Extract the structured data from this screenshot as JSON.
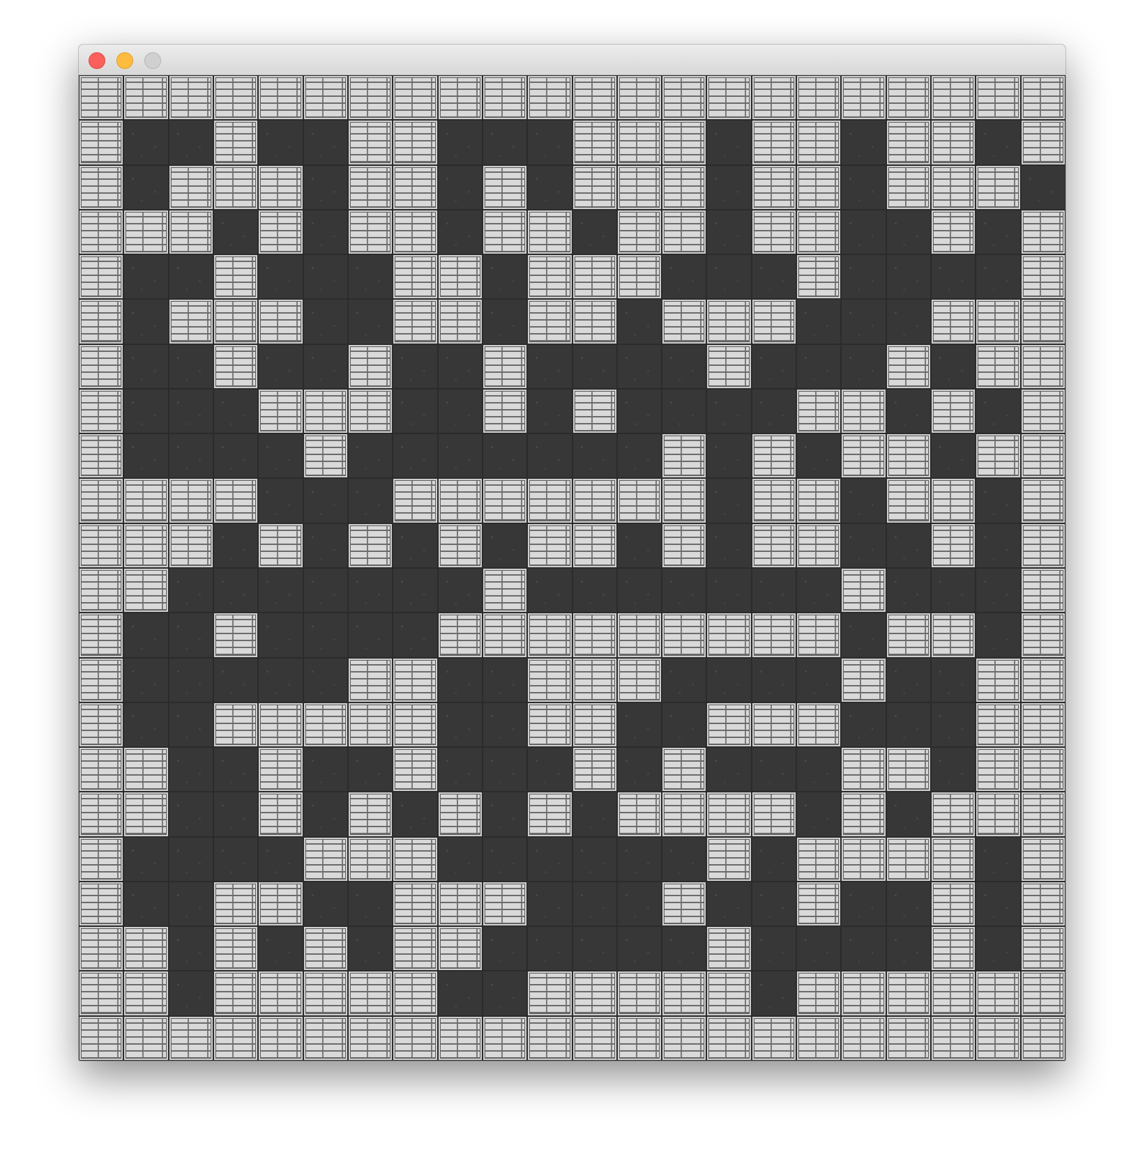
{
  "window": {
    "title": "",
    "controls": [
      "close",
      "minimize",
      "zoom"
    ]
  },
  "colors": {
    "wall": "#d9d9d9",
    "wall_mortar": "#6b6b6b",
    "floor": "#373737",
    "close": "#fc605c",
    "minimize": "#fdbc40",
    "zoom": "#d0d0d0"
  },
  "map": {
    "legend": {
      "#": "wall",
      ".": "floor"
    },
    "rows": [
      "######################",
      "#..#..##...###.##.##.#",
      "#.###.##.#.###.##.###.#",
      "###.#.##.##.##.##..#.#",
      "#..#...##.###...#....#",
      "#.###..##.##.###...###",
      "#..#..#..#....#...#.##",
      "#...###..#.#....##.#.#",
      "#....#.......#.#.##.#",
      "####...#######.##.##.#",
      "###.#.#.#.##.#.##..#.#",
      "##.......#.......#...#",
      "#..#....#########.##.#",
      "#.....##..###....#..##",
      "#..#####..##..###...##",
      "##..#..#...#.#...##.##",
      "##..#.#.#.#.####.#.###",
      "#....###......#.####.#",
      "#..##..###...#..#..#.#",
      "##.#.#.##.....#....#.#",
      "##.#####..#####.#####",
      "######################"
    ]
  }
}
